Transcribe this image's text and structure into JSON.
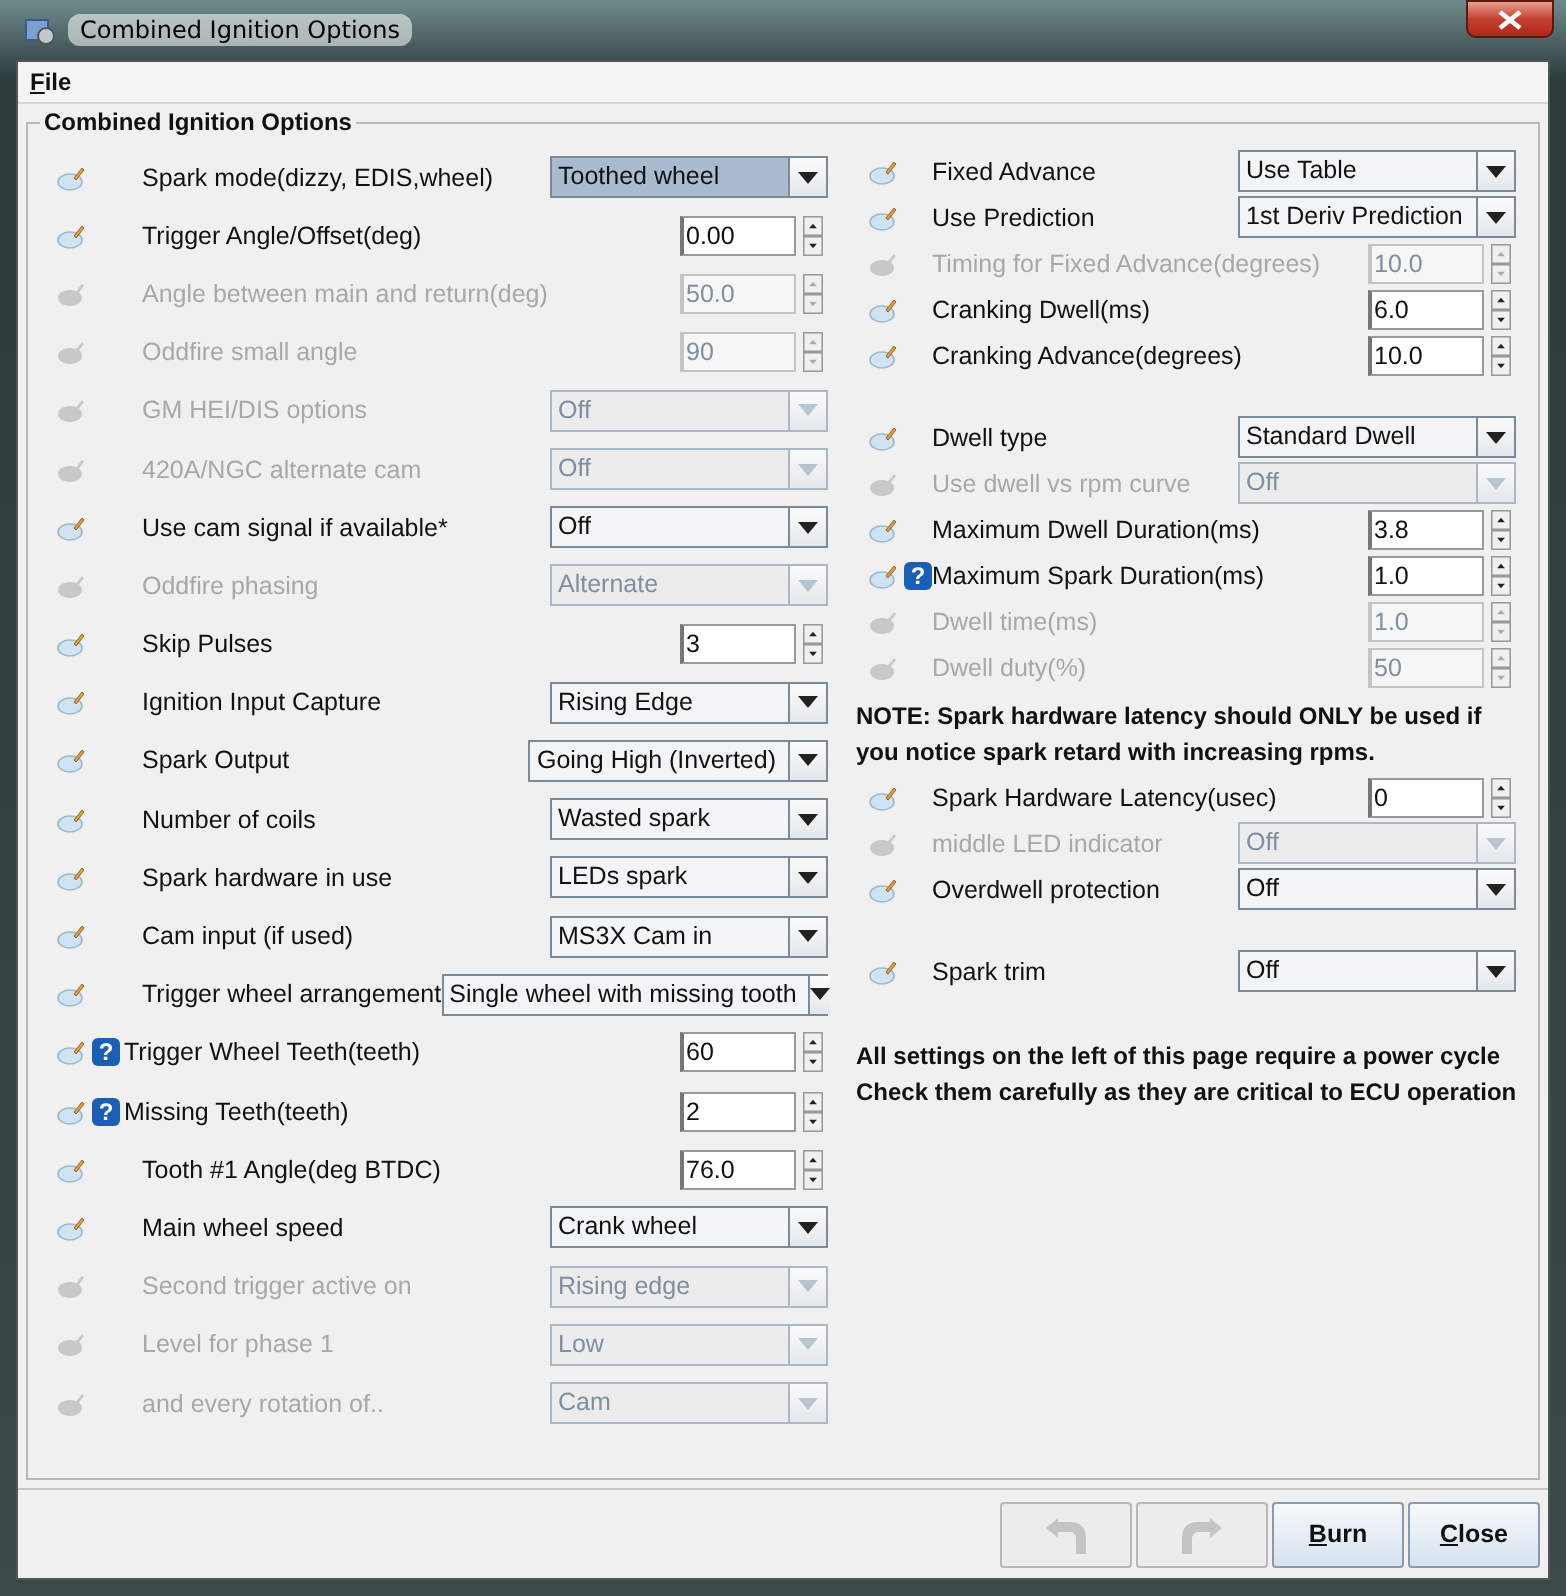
{
  "window": {
    "title": "Combined Ignition Options"
  },
  "menu": [
    "File"
  ],
  "panel": {
    "title": "Combined Ignition Options",
    "left": [
      {
        "kind": "select",
        "label": "Spark mode(dizzy, EDIS,wheel)",
        "value": "Toothed wheel",
        "disabled": false,
        "focused": true
      },
      {
        "kind": "spinner",
        "label": "Trigger Angle/Offset(deg)",
        "value": "0.00",
        "disabled": false
      },
      {
        "kind": "spinner",
        "label": "Angle between main and return(deg)",
        "value": "50.0",
        "disabled": true
      },
      {
        "kind": "spinner",
        "label": "Oddfire small angle",
        "value": "90",
        "disabled": true
      },
      {
        "kind": "select",
        "label": "GM HEI/DIS options",
        "value": "Off",
        "disabled": true,
        "focused": false
      },
      {
        "kind": "select",
        "label": "420A/NGC alternate cam",
        "value": "Off",
        "disabled": true,
        "focused": false
      },
      {
        "kind": "select",
        "label": "Use cam signal if available*",
        "value": "Off",
        "disabled": false,
        "focused": false
      },
      {
        "kind": "select",
        "label": "Oddfire phasing",
        "value": "Alternate",
        "disabled": true,
        "focused": false
      },
      {
        "kind": "spinner",
        "label": "Skip Pulses",
        "value": "3",
        "disabled": false
      },
      {
        "kind": "select",
        "label": "Ignition Input Capture",
        "value": "Rising Edge",
        "disabled": false,
        "focused": false
      },
      {
        "kind": "select",
        "label": "Spark Output",
        "value": "Going High (Inverted)",
        "disabled": false,
        "focused": false
      },
      {
        "kind": "select",
        "label": "Number of coils",
        "value": "Wasted spark",
        "disabled": false,
        "focused": false
      },
      {
        "kind": "select",
        "label": "Spark hardware in use",
        "value": "LEDs spark",
        "disabled": false,
        "focused": false
      },
      {
        "kind": "select",
        "label": "Cam input (if used)",
        "value": "MS3X Cam in",
        "disabled": false,
        "focused": false
      },
      {
        "kind": "select",
        "label": "Trigger wheel arrangement",
        "value": "Single wheel with missing tooth",
        "disabled": false,
        "focused": false
      },
      {
        "kind": "spinner",
        "label": "Trigger Wheel Teeth(teeth)",
        "value": "60",
        "disabled": false,
        "help": "?"
      },
      {
        "kind": "spinner",
        "label": "Missing Teeth(teeth)",
        "value": "2",
        "disabled": false,
        "help": "?"
      },
      {
        "kind": "spinner",
        "label": "Tooth #1 Angle(deg BTDC)",
        "value": "76.0",
        "disabled": false
      },
      {
        "kind": "select",
        "label": "Main wheel speed",
        "value": "Crank wheel",
        "disabled": false,
        "focused": false
      },
      {
        "kind": "select",
        "label": "Second trigger active on",
        "value": "Rising edge",
        "disabled": true,
        "focused": false
      },
      {
        "kind": "select",
        "label": "Level for phase 1",
        "value": "Low",
        "disabled": true,
        "focused": false
      },
      {
        "kind": "select",
        "label": "and every rotation of..",
        "value": "Cam",
        "disabled": true,
        "focused": false
      }
    ],
    "right": [
      {
        "kind": "select",
        "label": "Fixed Advance",
        "value": "Use Table",
        "disabled": false,
        "focused": false
      },
      {
        "kind": "select",
        "label": "Use Prediction",
        "value": "1st Deriv Prediction",
        "disabled": false,
        "focused": false
      },
      {
        "kind": "spinner",
        "label": "Timing for Fixed Advance(degrees)",
        "value": "10.0",
        "disabled": true
      },
      {
        "kind": "spinner",
        "label": "Cranking Dwell(ms)",
        "value": "6.0",
        "disabled": false
      },
      {
        "kind": "spinner",
        "label": "Cranking Advance(degrees)",
        "value": "10.0",
        "disabled": false
      },
      {
        "kind": "gap"
      },
      {
        "kind": "select",
        "label": "Dwell type",
        "value": "Standard Dwell",
        "disabled": false,
        "focused": false
      },
      {
        "kind": "select",
        "label": "Use dwell vs rpm curve",
        "value": "Off",
        "disabled": true,
        "focused": false
      },
      {
        "kind": "spinner",
        "label": "Maximum Dwell Duration(ms)",
        "value": "3.8",
        "disabled": false
      },
      {
        "kind": "spinner",
        "label": "Maximum Spark Duration(ms)",
        "value": "1.0",
        "disabled": false,
        "help": "?"
      },
      {
        "kind": "spinner",
        "label": "Dwell time(ms)",
        "value": "1.0",
        "disabled": true
      },
      {
        "kind": "spinner",
        "label": "Dwell duty(%)",
        "value": "50",
        "disabled": true
      },
      {
        "kind": "note",
        "lines": [
          "NOTE: Spark hardware latency should ONLY be used if",
          "you notice spark retard with increasing rpms."
        ]
      },
      {
        "kind": "spinner",
        "label": "Spark Hardware Latency(usec)",
        "value": "0",
        "disabled": false
      },
      {
        "kind": "select",
        "label": "middle LED indicator",
        "value": "Off",
        "disabled": true,
        "focused": false
      },
      {
        "kind": "select",
        "label": "Overdwell protection",
        "value": "Off",
        "disabled": false,
        "focused": false
      },
      {
        "kind": "gap"
      },
      {
        "kind": "select",
        "label": "Spark trim",
        "value": "Off",
        "disabled": false,
        "focused": false
      },
      {
        "kind": "gap"
      },
      {
        "kind": "note",
        "lines": [
          "All settings on the left of this page require a power cycle",
          "Check them carefully as they are critical to ECU operation"
        ]
      }
    ]
  },
  "buttons": [
    {
      "kind": "undo",
      "disabled": true
    },
    {
      "kind": "redo",
      "disabled": true
    },
    {
      "kind": "text",
      "label": "Burn",
      "disabled": false
    },
    {
      "kind": "text",
      "label": "Close",
      "disabled": false
    }
  ]
}
